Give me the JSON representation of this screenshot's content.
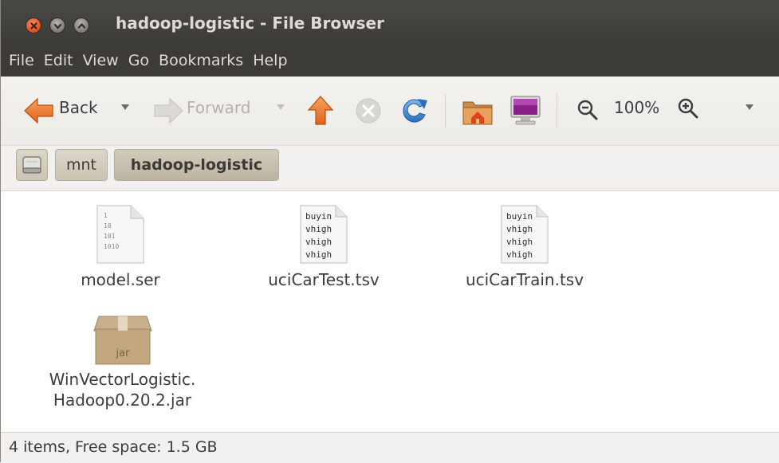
{
  "window": {
    "title": "hadoop-logistic - File Browser"
  },
  "menubar": {
    "items": [
      "File",
      "Edit",
      "View",
      "Go",
      "Bookmarks",
      "Help"
    ]
  },
  "toolbar": {
    "back_label": "Back",
    "forward_label": "Forward",
    "zoom_level": "100%",
    "icons": [
      "back-arrow-icon",
      "forward-arrow-icon",
      "up-arrow-icon",
      "stop-icon",
      "reload-icon",
      "home-folder-icon",
      "computer-icon",
      "zoom-out-icon",
      "zoom-in-icon"
    ]
  },
  "location": {
    "crumbs": [
      "mnt",
      "hadoop-logistic"
    ]
  },
  "files": [
    {
      "name": "model.ser",
      "type": "binary",
      "preview": [
        "1",
        "10",
        "101",
        "1010"
      ]
    },
    {
      "name": "uciCarTest.tsv",
      "type": "text",
      "preview": [
        "buyin",
        "vhigh",
        "vhigh",
        "vhigh"
      ]
    },
    {
      "name": "uciCarTrain.tsv",
      "type": "text",
      "preview": [
        "buyin",
        "vhigh",
        "vhigh",
        "vhigh"
      ]
    },
    {
      "name_lines": [
        "WinVectorLogistic.",
        "Hadoop0.20.2.jar"
      ],
      "type": "jar",
      "badge": "jar"
    }
  ],
  "status": {
    "text": "4 items, Free space: 1.5 GB"
  },
  "colors": {
    "titlebar": "#3c3b37",
    "close_button": "#e2582a",
    "accent_home": "#e05a22"
  }
}
